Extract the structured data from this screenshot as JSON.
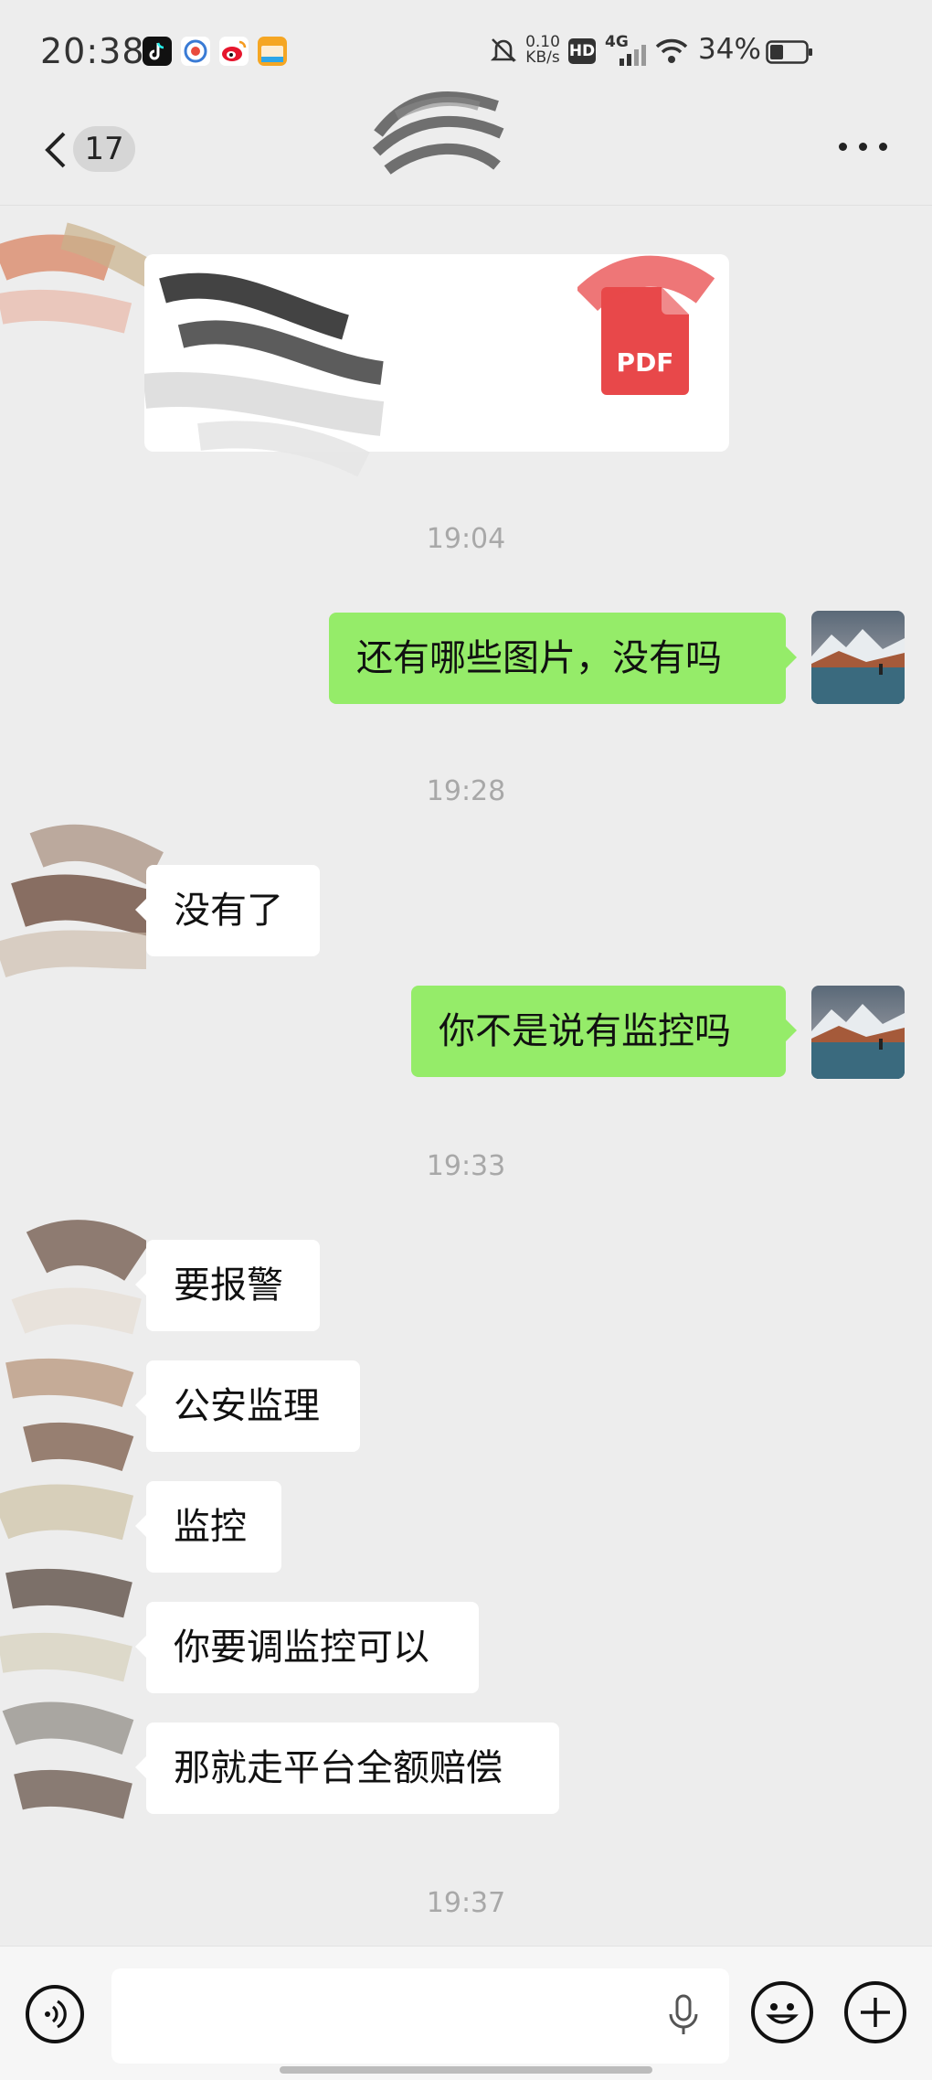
{
  "status_bar": {
    "time": "20:38",
    "network_speed_value": "0.10",
    "network_speed_unit": "KB/s",
    "hd_badge": "HD",
    "network_type": "4G",
    "battery": "34%",
    "icons": [
      "tiktok-icon",
      "browser-icon",
      "weibo-icon",
      "shopping-app-icon",
      "mute-bell-icon",
      "signal-icon",
      "wifi-icon",
      "battery-icon"
    ]
  },
  "header": {
    "unread_count": "17"
  },
  "messages": {
    "t1": "19:04",
    "m1": "还有哪些图片，没有吗",
    "t2": "19:28",
    "m2": "没有了",
    "m3": "你不是说有监控吗",
    "t3": "19:33",
    "m4": "要报警",
    "m5": "公安监理",
    "m6": "监控",
    "m7": "你要调监控可以",
    "m8": "那就走平台全额赔偿",
    "t4": "19:37"
  },
  "file_card": {
    "file_type": "PDF"
  },
  "colors": {
    "bg": "#ededed",
    "outgoing_bubble": "#95ec69",
    "incoming_bubble": "#ffffff",
    "pdf_red": "#e8484a"
  }
}
